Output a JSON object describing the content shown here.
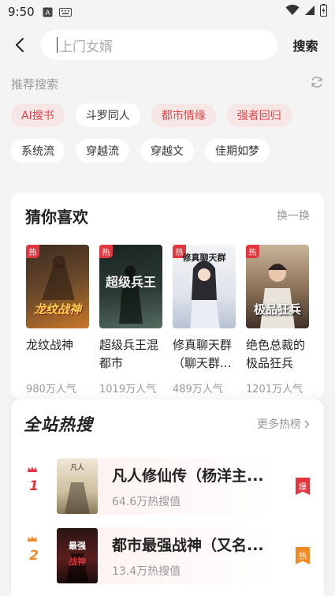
{
  "status_bar": {
    "time": "9:50"
  },
  "search": {
    "placeholder": "上门女婿",
    "button_label": "搜索"
  },
  "recommended": {
    "title": "推荐搜索",
    "tags_row1": [
      {
        "label": "AI搜书",
        "hot": true
      },
      {
        "label": "斗罗同人",
        "hot": false
      },
      {
        "label": "都市情缘",
        "hot": true
      },
      {
        "label": "强者回归",
        "hot": true
      }
    ],
    "tags_row2": [
      {
        "label": "系统流",
        "hot": false
      },
      {
        "label": "穿越流",
        "hot": false
      },
      {
        "label": "穿越文",
        "hot": false
      },
      {
        "label": "佳期如梦",
        "hot": false
      }
    ]
  },
  "guess": {
    "title": "猜你喜欢",
    "action": "换一换",
    "books": [
      {
        "title": "龙纹战神",
        "popularity": "980万人气",
        "badge": "热",
        "cover_text": "龙纹战神",
        "cover_color": "#6b4a2a"
      },
      {
        "title": "超级兵王混都市",
        "popularity": "1019万人气",
        "badge": "热",
        "cover_text": "超级兵王",
        "cover_color": "#2b3a35"
      },
      {
        "title": "修真聊天群（聊天群...",
        "popularity": "489万人气",
        "badge": "热",
        "cover_text": "修真聊天群",
        "cover_color": "#dfe3ea"
      },
      {
        "title": "绝色总裁的极品狂兵",
        "popularity": "1201万人气",
        "badge": "热",
        "cover_text": "极品狂兵",
        "cover_color": "#8a6f55"
      }
    ]
  },
  "hot_search": {
    "title": "全站热搜",
    "more": "更多热榜",
    "items": [
      {
        "rank": "1",
        "title": "凡人修仙传（杨洋主...",
        "heat": "64.6万热搜值",
        "badge": "爆",
        "rank_color": "#e0383e",
        "badge_color": "#e0383e"
      },
      {
        "rank": "2",
        "title": "都市最强战神（又名...",
        "heat": "13.4万热搜值",
        "badge": "热",
        "rank_color": "#f08a24",
        "badge_color": "#f08a24"
      }
    ]
  }
}
